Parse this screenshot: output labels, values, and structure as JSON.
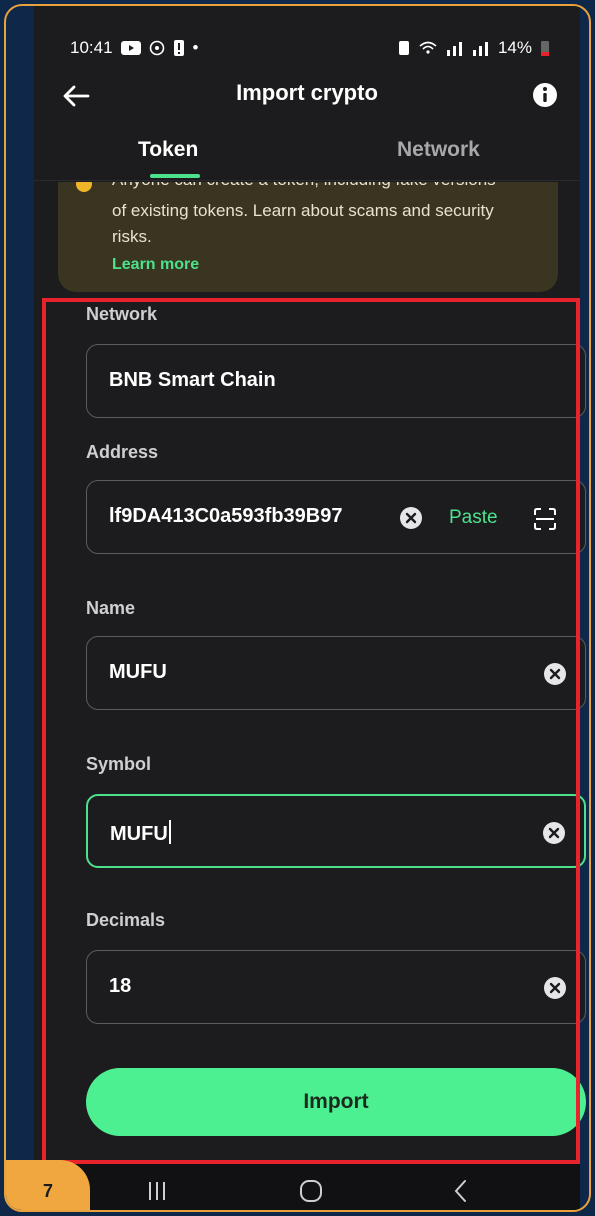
{
  "status_bar": {
    "time": "10:41",
    "battery": "14%"
  },
  "header": {
    "title": "Import crypto",
    "back_icon": "arrow-left-icon",
    "info_icon": "info-icon"
  },
  "tabs": [
    {
      "label": "Token",
      "active": true
    },
    {
      "label": "Network",
      "active": false
    }
  ],
  "warning": {
    "clipped_text": "Anyone can create a token, including fake versions",
    "text": "of existing tokens. Learn about scams and security risks.",
    "link": "Learn more"
  },
  "form": {
    "network": {
      "label": "Network",
      "value": "BNB Smart Chain"
    },
    "address": {
      "label": "Address",
      "value": "lf9DA413C0a593fb39B97",
      "paste_label": "Paste"
    },
    "name": {
      "label": "Name",
      "value": "MUFU"
    },
    "symbol": {
      "label": "Symbol",
      "value": "MUFU"
    },
    "decimals": {
      "label": "Decimals",
      "value": "18"
    }
  },
  "import_button": "Import",
  "step_badge": "7",
  "colors": {
    "accent": "#4df091",
    "highlight": "#e8232b",
    "badge": "#f0a73f"
  }
}
